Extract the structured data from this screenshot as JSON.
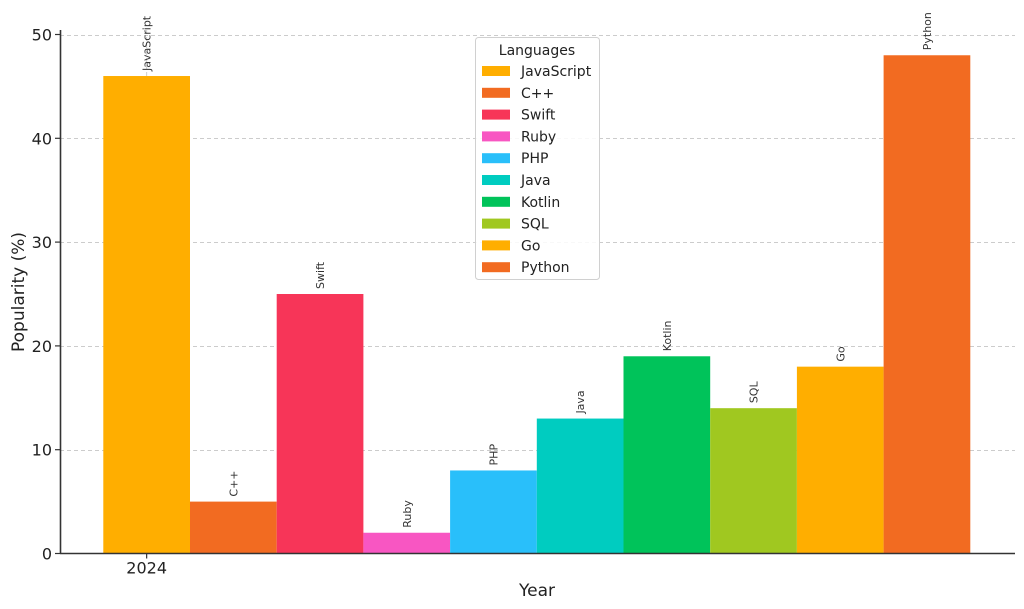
{
  "chart_data": {
    "type": "bar",
    "title": "",
    "xlabel": "Year",
    "ylabel": "Popularity (%)",
    "categories": [
      "2024"
    ],
    "ylim": [
      0,
      50
    ],
    "yticks": [
      0,
      10,
      20,
      30,
      40,
      50
    ],
    "grid": true,
    "legend": {
      "title": "Languages",
      "placement": "top-center"
    },
    "series": [
      {
        "name": "JavaScript",
        "values": [
          46
        ],
        "color": "#FFAE00"
      },
      {
        "name": "C++",
        "values": [
          5
        ],
        "color": "#F26B21"
      },
      {
        "name": "Swift",
        "values": [
          25
        ],
        "color": "#F73558"
      },
      {
        "name": "Ruby",
        "values": [
          2
        ],
        "color": "#F856C2"
      },
      {
        "name": "PHP",
        "values": [
          8
        ],
        "color": "#29BFFA"
      },
      {
        "name": "Java",
        "values": [
          13
        ],
        "color": "#00CCC0"
      },
      {
        "name": "Kotlin",
        "values": [
          19
        ],
        "color": "#00C35A"
      },
      {
        "name": "SQL",
        "values": [
          14
        ],
        "color": "#A0C820"
      },
      {
        "name": "Go",
        "values": [
          18
        ],
        "color": "#FFAE00"
      },
      {
        "name": "Python",
        "values": [
          48
        ],
        "color": "#F26B21"
      }
    ]
  }
}
